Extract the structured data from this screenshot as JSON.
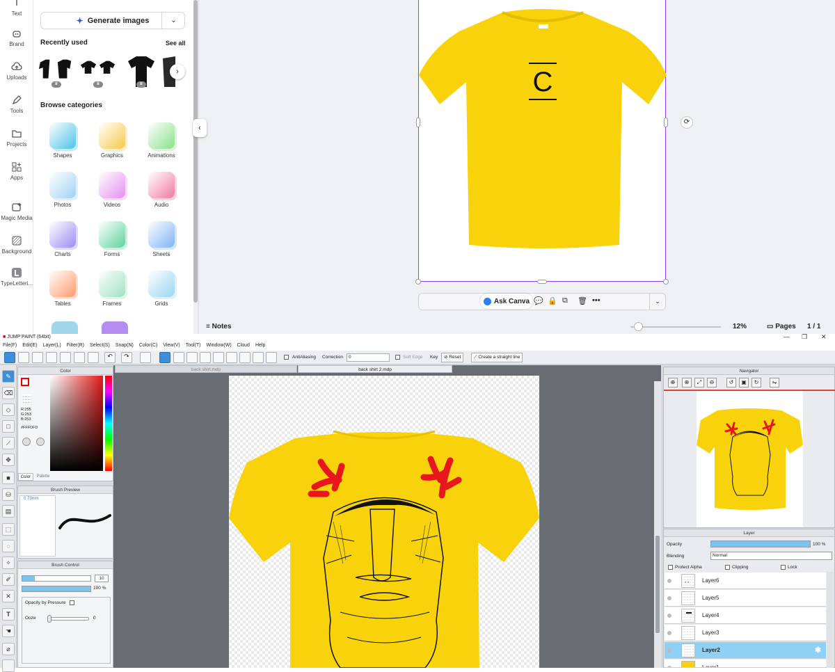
{
  "canva": {
    "rail": [
      {
        "label": "Text",
        "icon": "text-icon"
      },
      {
        "label": "Brand",
        "icon": "brand-icon"
      },
      {
        "label": "Uploads",
        "icon": "upload-icon"
      },
      {
        "label": "Tools",
        "icon": "pen-icon"
      },
      {
        "label": "Projects",
        "icon": "folder-icon"
      },
      {
        "label": "Apps",
        "icon": "apps-icon"
      },
      {
        "label": "Magic Media",
        "icon": "magic-media-icon"
      },
      {
        "label": "Background",
        "icon": "background-icon"
      },
      {
        "label": "TypeLetteri...",
        "icon": "typelettering-icon"
      }
    ],
    "panel": {
      "generate_label": "Generate images",
      "recently_used_title": "Recently used",
      "see_all": "See all",
      "browse_title": "Browse categories",
      "categories": [
        {
          "label": "Shapes",
          "color": "#4cc3e8"
        },
        {
          "label": "Graphics",
          "color": "#f7c948"
        },
        {
          "label": "Animations",
          "color": "#8be08b"
        },
        {
          "label": "Photos",
          "color": "#9fd3f2"
        },
        {
          "label": "Videos",
          "color": "#e68ff0"
        },
        {
          "label": "Audio",
          "color": "#f07aa0"
        },
        {
          "label": "Charts",
          "color": "#9b8cf5"
        },
        {
          "label": "Forms",
          "color": "#5dd39e"
        },
        {
          "label": "Sheets",
          "color": "#7fb3f5"
        },
        {
          "label": "Tables",
          "color": "#ff9a6b"
        },
        {
          "label": "Frames",
          "color": "#9ee0c4"
        },
        {
          "label": "Grids",
          "color": "#9ad7f0"
        }
      ]
    },
    "design": {
      "logo_letter": "C",
      "shirt_color": "#f8d20a"
    },
    "toolbar": {
      "ask_label": "Ask Canva"
    },
    "bottom": {
      "notes_label": "Notes",
      "zoom": "12%",
      "pages_label": "Pages",
      "page_count": "1 / 1"
    }
  },
  "jump": {
    "title": "JUMP PAINT (64bit)",
    "menu": [
      "File(F)",
      "Edit(E)",
      "Layer(L)",
      "Filter(R)",
      "Select(S)",
      "Snap(N)",
      "Color(C)",
      "View(V)",
      "Tool(T)",
      "Window(W)",
      "Cloud",
      "Help"
    ],
    "toolbar": {
      "antialiasing": "AntiAliasing",
      "correction_label": "Correction",
      "correction_value": "0",
      "soft_edge": "Soft Edge",
      "key": "Key",
      "reset": "Reset",
      "straight_line": "Create a straight line"
    },
    "tabs": [
      "back shirt.mdp",
      "back shirt 2.mdp"
    ],
    "color_panel": {
      "title": "Color",
      "r": "R:255",
      "g": "G:253",
      "b": "B:253",
      "hex": "#FFFDFD",
      "tab_color": "Color",
      "tab_palette": "Palette"
    },
    "brush_preview": {
      "title": "Brush Preview",
      "size": "0.73mm"
    },
    "brush_control": {
      "title": "Brush Control",
      "size_value": "10",
      "opacity_value": "100 %",
      "opacity_by_pressure": "Opacity by Pressure",
      "ooze_label": "Ooze",
      "ooze_value": "0"
    },
    "navigator": {
      "title": "Navigator"
    },
    "layer_panel": {
      "title": "Layer",
      "opacity_label": "Opacity",
      "opacity_value": "100 %",
      "blending_label": "Blending",
      "blending_value": "Normal",
      "protect_alpha": "Protect Alpha",
      "clipping": "Clipping",
      "lock": "Lock",
      "layers": [
        "Layer6",
        "Layer5",
        "Layer4",
        "Layer3",
        "Layer2",
        "Layer1"
      ],
      "selected": "Layer2"
    },
    "colors": {
      "accent": "#3c8fd8",
      "anger": "#e8171b",
      "shirt": "#f8d20a"
    }
  }
}
